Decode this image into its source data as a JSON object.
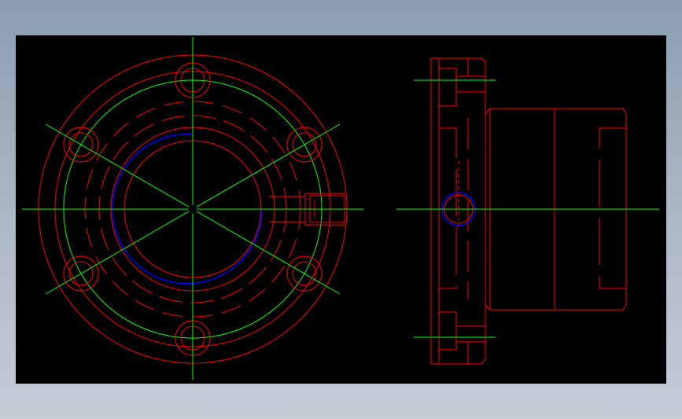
{
  "drawing": {
    "background": "#000000",
    "colors": {
      "outline": "#ff0000",
      "centerline": "#00ff00",
      "thread": "#0000ff"
    },
    "views": [
      {
        "name": "front-view",
        "kind": "circular-flange",
        "bolt_holes": 6
      },
      {
        "name": "side-view",
        "kind": "section-profile"
      }
    ]
  }
}
